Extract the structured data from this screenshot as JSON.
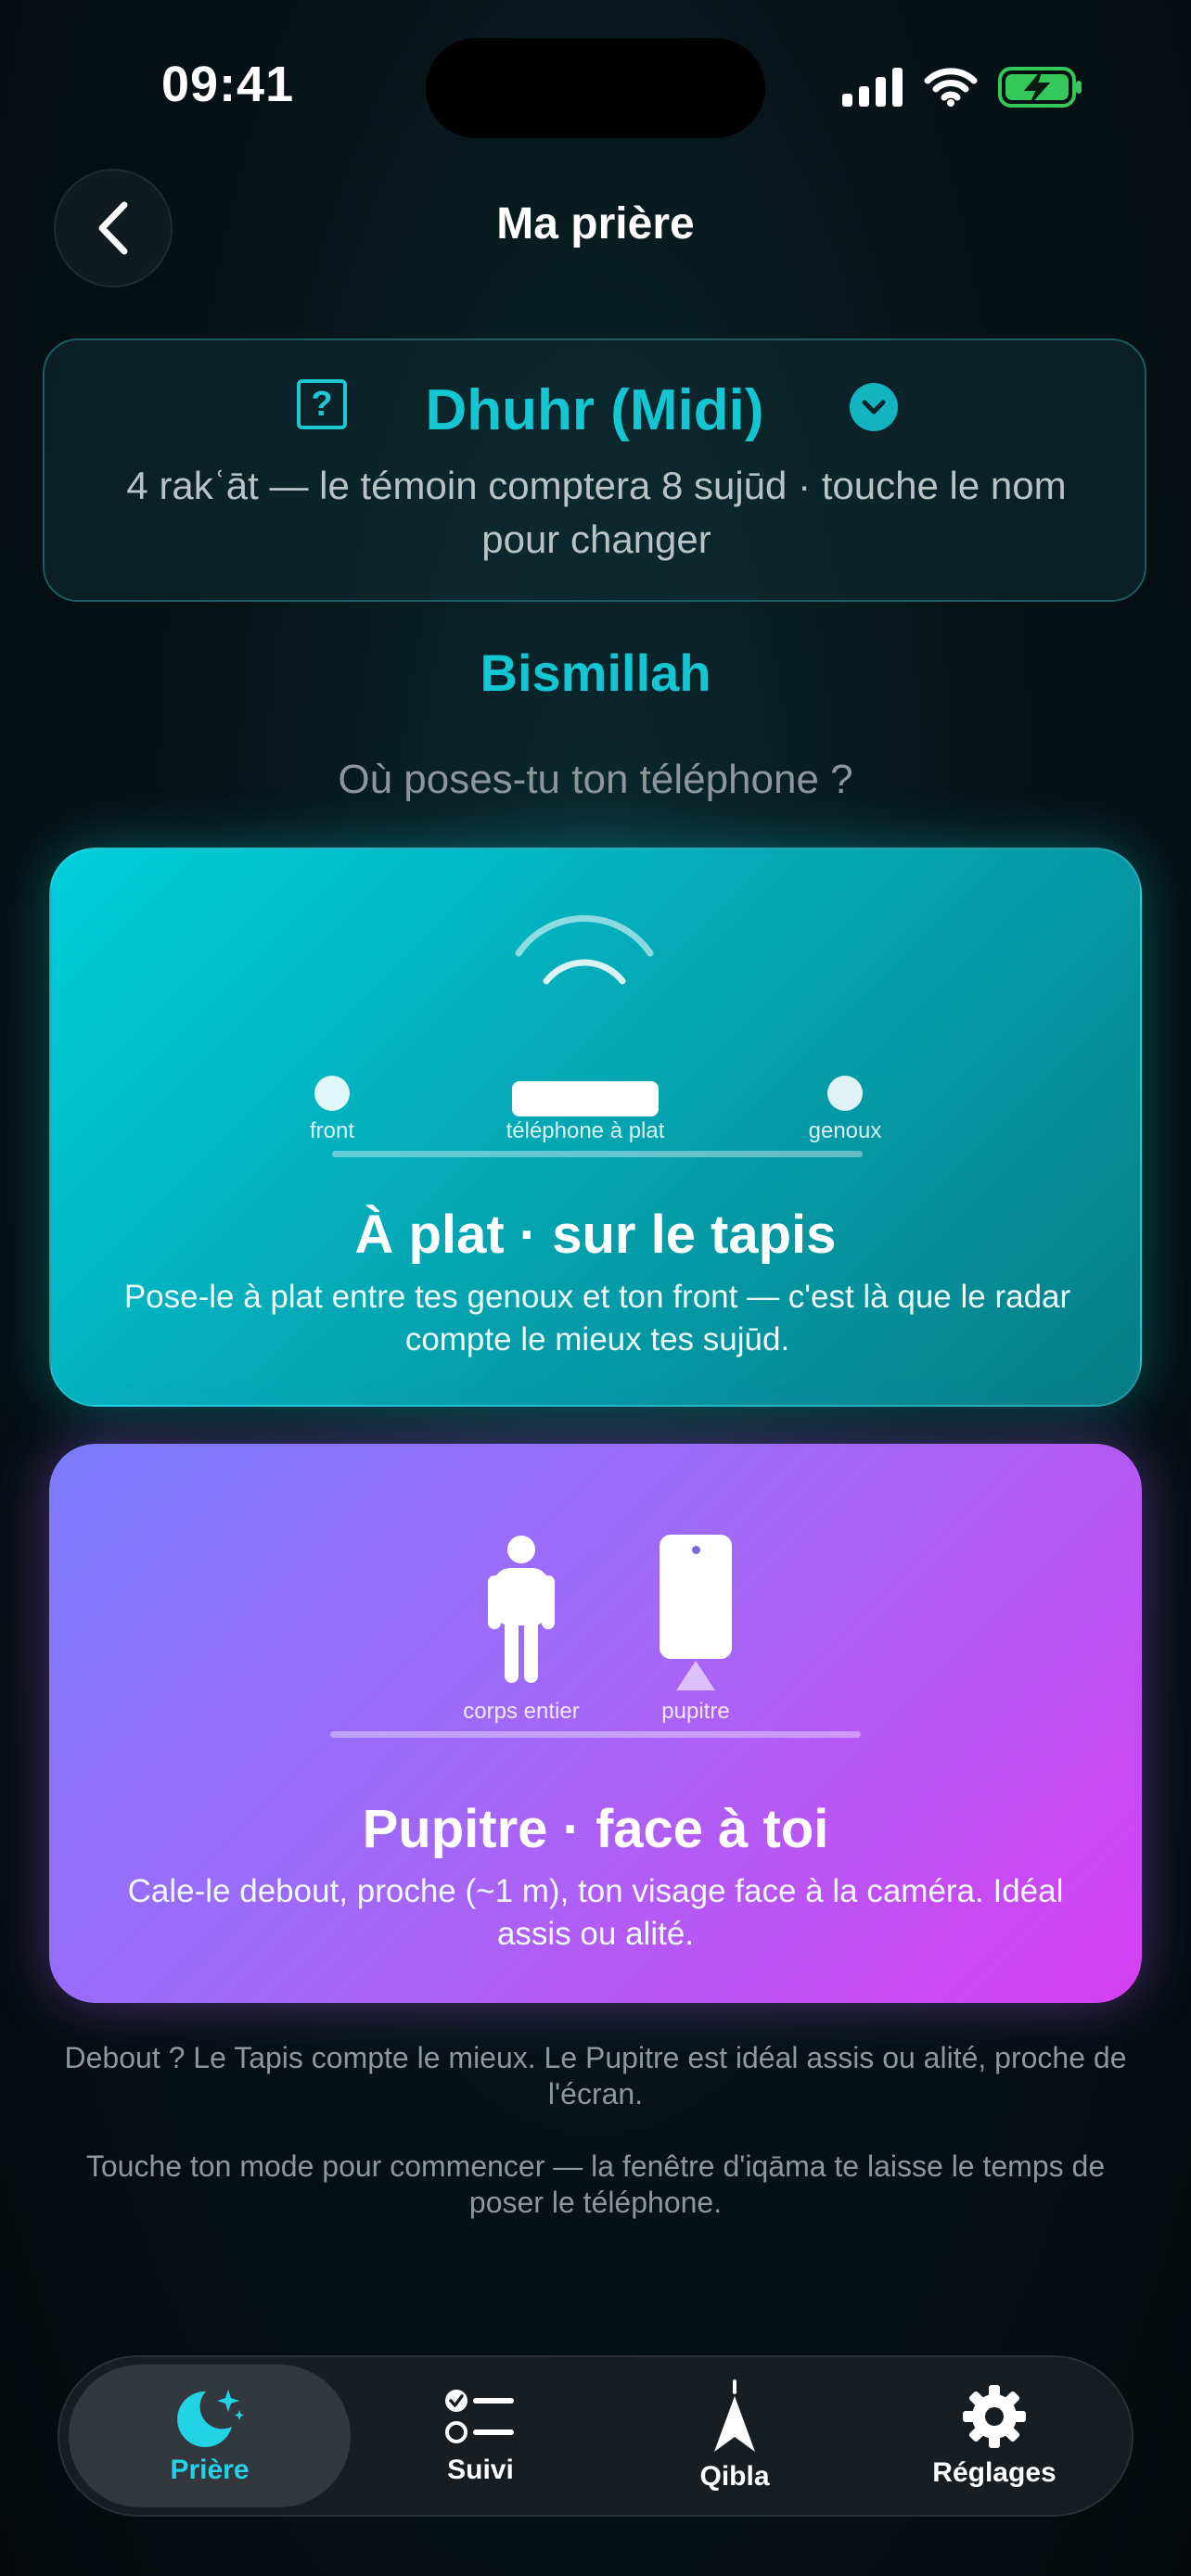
{
  "status_bar": {
    "time": "09:41"
  },
  "header": {
    "title": "Ma prière"
  },
  "prayer": {
    "name": "Dhuhr (Midi)",
    "subtitle": "4 rakʿāt — le témoin comptera 8 sujūd · touche le nom pour changer",
    "help_glyph": "?"
  },
  "greeting": "Bismillah",
  "question": "Où poses-tu ton téléphone ?",
  "modes": [
    {
      "title": "À plat · sur le tapis",
      "description": "Pose-le à plat entre tes genoux et ton front — c'est là que le radar compte le mieux tes sujūd.",
      "labels": {
        "left": "front",
        "center": "téléphone à plat",
        "right": "genoux"
      }
    },
    {
      "title": "Pupitre · face à toi",
      "description": "Cale-le debout, proche (~1 m), ton visage face à la caméra. Idéal assis ou alité.",
      "labels": {
        "left": "corps entier",
        "right": "pupitre"
      }
    }
  ],
  "notes": [
    "Debout ? Le Tapis compte le mieux. Le Pupitre est idéal assis ou alité, proche de l'écran.",
    "Touche ton mode pour commencer — la fenêtre d'iqāma te laisse le temps de poser le téléphone."
  ],
  "tabs": [
    {
      "label": "Prière",
      "icon": "moon-stars-icon",
      "active": true
    },
    {
      "label": "Suivi",
      "icon": "checklist-icon",
      "active": false
    },
    {
      "label": "Qibla",
      "icon": "compass-arrow-icon",
      "active": false
    },
    {
      "label": "Réglages",
      "icon": "gear-icon",
      "active": false
    }
  ],
  "colors": {
    "accent": "#14c5d2",
    "flat_card_start": "#00cfdc",
    "flat_card_end": "#067d86",
    "desk_card_start": "#7b7cff",
    "desk_card_end": "#d63ff0",
    "battery": "#34c759"
  }
}
